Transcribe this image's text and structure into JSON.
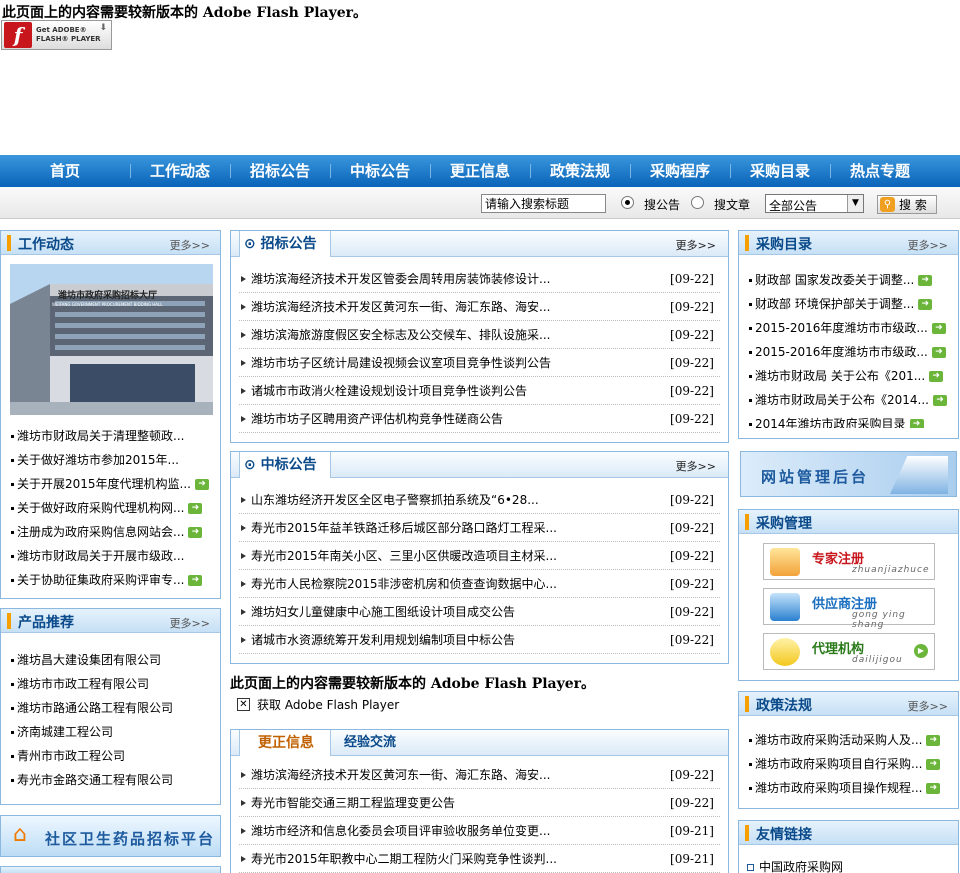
{
  "flash": {
    "message": "此页面上的内容需要较新版本的  Adobe Flash Player。",
    "get_label_line1": "Get ADOBE®",
    "get_label_line2": "FLASH® PLAYER",
    "logo_letter": "f",
    "get_link": "获取 Adobe Flash Player"
  },
  "nav": {
    "items": [
      "首页",
      "工作动态",
      "招标公告",
      "中标公告",
      "更正信息",
      "政策法规",
      "采购程序",
      "采购目录",
      "热点专题"
    ]
  },
  "search": {
    "placeholder": "请输入搜索标题",
    "radio1": "搜公告",
    "radio2": "搜文章",
    "select_value": "全部公告",
    "button": "搜 索"
  },
  "more_label": "更多>>",
  "work": {
    "title": "工作动态",
    "image_sign": "潍坊市政府采购招标大厅",
    "image_sign_en": "WEIFANG GOVERNMENT PROCUREMENT BIDDING HALL",
    "items": [
      {
        "text": "潍坊市财政局关于清理整顿政...",
        "new": false
      },
      {
        "text": "关于做好潍坊市参加2015年...",
        "new": false
      },
      {
        "text": "关于开展2015年度代理机构监...",
        "new": true
      },
      {
        "text": "关于做好政府采购代理机构网...",
        "new": true
      },
      {
        "text": "注册成为政府采购信息网站会...",
        "new": true
      },
      {
        "text": "潍坊市财政局关于开展市级政...",
        "new": false
      },
      {
        "text": "关于协助征集政府采购评审专...",
        "new": true
      }
    ]
  },
  "products": {
    "title": "产品推荐",
    "items": [
      "潍坊昌大建设集团有限公司",
      "潍坊市市政工程有限公司",
      "潍坊市路通公路工程有限公司",
      "济南城建工程公司",
      "青州市市政工程公司",
      "寿光市金路交通工程有限公司"
    ]
  },
  "community_banner": "社区卫生药品招标平台",
  "bidding": {
    "title": "招标公告",
    "items": [
      {
        "text": "潍坊滨海经济技术开发区管委会周转用房装饰装修设计...",
        "date": "[09-22]"
      },
      {
        "text": "潍坊滨海经济技术开发区黄河东一街、海汇东路、海安...",
        "date": "[09-22]"
      },
      {
        "text": "潍坊滨海旅游度假区安全标志及公交候车、排队设施采...",
        "date": "[09-22]"
      },
      {
        "text": "潍坊市坊子区统计局建设视频会议室项目竞争性谈判公告",
        "date": "[09-22]"
      },
      {
        "text": "诸城市市政消火栓建设规划设计项目竞争性谈判公告",
        "date": "[09-22]"
      },
      {
        "text": "潍坊市坊子区聘用资产评估机构竞争性磋商公告",
        "date": "[09-22]"
      }
    ]
  },
  "award": {
    "title": "中标公告",
    "items": [
      {
        "text": "山东潍坊经济开发区全区电子警察抓拍系统及“6•28...",
        "date": "[09-22]"
      },
      {
        "text": "寿光市2015年益羊铁路迁移后城区部分路口路灯工程采...",
        "date": "[09-22]"
      },
      {
        "text": "寿光市2015年南关小区、三里小区供暖改造项目主材采...",
        "date": "[09-22]"
      },
      {
        "text": "寿光市人民检察院2015非涉密机房和侦查查询数据中心...",
        "date": "[09-22]"
      },
      {
        "text": "潍坊妇女儿童健康中心施工图纸设计项目成交公告",
        "date": "[09-22]"
      },
      {
        "text": "诸城市水资源统筹开发利用规划编制项目中标公告",
        "date": "[09-22]"
      }
    ]
  },
  "tabs": {
    "tab1": "更正信息",
    "tab2": "经验交流",
    "items": [
      {
        "text": "潍坊滨海经济技术开发区黄河东一街、海汇东路、海安...",
        "date": "[09-22]"
      },
      {
        "text": "寿光市智能交通三期工程监理变更公告",
        "date": "[09-22]"
      },
      {
        "text": "潍坊市经济和信息化委员会项目评审验收服务单位变更...",
        "date": "[09-21]"
      },
      {
        "text": "寿光市2015年职教中心二期工程防火门采购竞争性谈判...",
        "date": "[09-21]"
      }
    ]
  },
  "catalog": {
    "title": "采购目录",
    "items": [
      "财政部 国家发改委关于调整...",
      "财政部 环境保护部关于调整...",
      "2015-2016年度潍坊市市级政...",
      "2015-2016年度潍坊市市级政...",
      "潍坊市财政局 关于公布《201...",
      "潍坊市财政局关于公布《2014...",
      "2014年潍坊市政府采购目录"
    ]
  },
  "admin_banner": "网站管理后台",
  "mgmt": {
    "title": "采购管理",
    "buttons": [
      {
        "label": "专家注册",
        "sub": "zhuanjiazhuce",
        "color": "#c8161d"
      },
      {
        "label": "供应商注册",
        "sub": "gong ying shang",
        "color": "#1a6fc0"
      },
      {
        "label": "代理机构",
        "sub": "dailijigou",
        "color": "#2a7a1a"
      }
    ]
  },
  "policy": {
    "title": "政策法规",
    "items": [
      "潍坊市政府采购活动采购人及...",
      "潍坊市政府采购项目自行采购...",
      "潍坊市政府采购项目操作规程..."
    ]
  },
  "links": {
    "title": "友情链接",
    "items": [
      "中国政府采购网"
    ]
  }
}
